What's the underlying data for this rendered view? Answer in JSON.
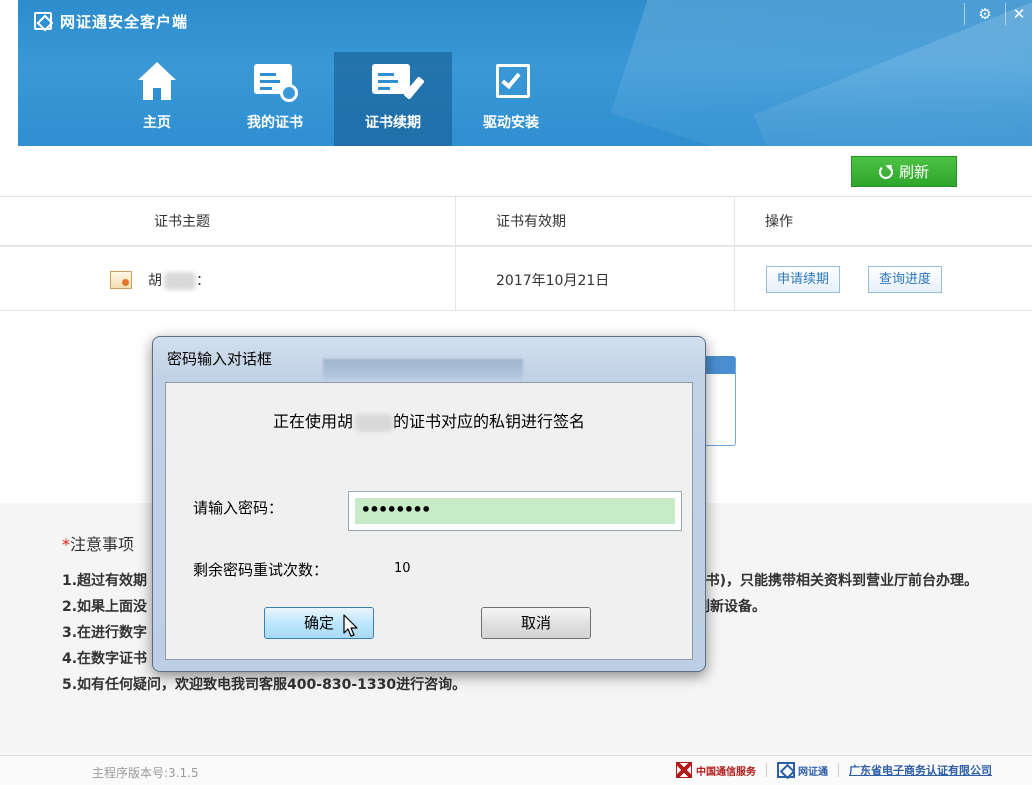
{
  "app": {
    "title": "网证通安全客户端"
  },
  "window": {
    "settings_glyph": "⚙",
    "close_glyph": "✕"
  },
  "nav": {
    "items": [
      {
        "label": "主页",
        "icon": "home-icon"
      },
      {
        "label": "我的证书",
        "icon": "my-certificate-icon"
      },
      {
        "label": "证书续期",
        "icon": "certificate-renewal-icon",
        "active": true
      },
      {
        "label": "驱动安装",
        "icon": "driver-install-icon"
      }
    ]
  },
  "toolbar": {
    "refresh_label": "刷新"
  },
  "table": {
    "headers": {
      "subject": "证书主题",
      "validity": "证书有效期",
      "operations": "操作"
    },
    "rows": [
      {
        "subject_visible": "胡",
        "subject_tail": "：",
        "validity": "2017年10月21日",
        "renew_label": "申请续期",
        "progress_label": "查询进度"
      }
    ]
  },
  "notes": {
    "title": "注意事项",
    "star": "*",
    "items": [
      "1.超过有效期",
      "2.如果上面没",
      "3.在进行数字",
      "4.在数字证书",
      "5.如有任何疑问，欢迎致电我司客服400-830-1330进行咨询。"
    ],
    "right_fragments": [
      "E书)，只能携带相关资料到营业厅前台办理。",
      "刷新设备。"
    ]
  },
  "footer": {
    "version": "主程序版本号:3.1.5",
    "logo_ct": "中国通信服务",
    "logo_nc": "网证通",
    "logo_ca": "广东省电子商务认证有限公司"
  },
  "dialog": {
    "title": "密码输入对话框",
    "sign_message_prefix": "正在使用胡",
    "sign_message_suffix": "的证书对应的私钥进行签名",
    "password_label": "请输入密码：",
    "password_value": "••••••••",
    "retry_label": "剩余密码重试次数：",
    "retry_count": "10",
    "ok_label": "确定",
    "cancel_label": "取消"
  },
  "colors": {
    "header_blue": "#2f8fd0",
    "refresh_green": "#2ea62b",
    "password_field_green": "#c6ebc6",
    "link_blue": "#2e77bf"
  }
}
